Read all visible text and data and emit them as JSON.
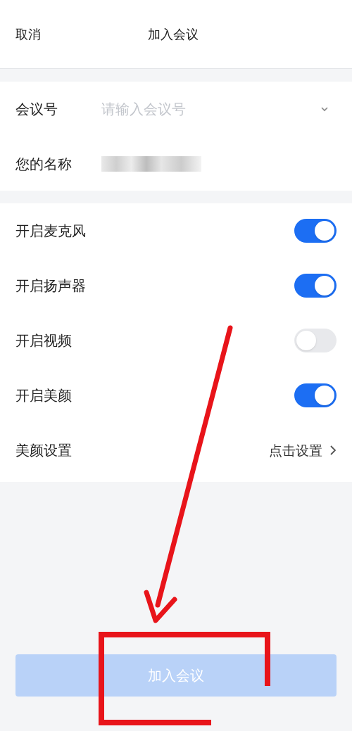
{
  "header": {
    "cancel": "取消",
    "title": "加入会议"
  },
  "form": {
    "meeting_number": {
      "label": "会议号",
      "placeholder": "请输入会议号"
    },
    "name": {
      "label": "您的名称"
    }
  },
  "settings": [
    {
      "kind": "toggle",
      "label": "开启麦克风",
      "on": true
    },
    {
      "kind": "toggle",
      "label": "开启扬声器",
      "on": true
    },
    {
      "kind": "toggle",
      "label": "开启视频",
      "on": false
    },
    {
      "kind": "toggle",
      "label": "开启美颜",
      "on": true
    },
    {
      "kind": "link",
      "label": "美颜设置",
      "value": "点击设置"
    }
  ],
  "join_button": {
    "label": "加入会议",
    "disabled": true
  }
}
